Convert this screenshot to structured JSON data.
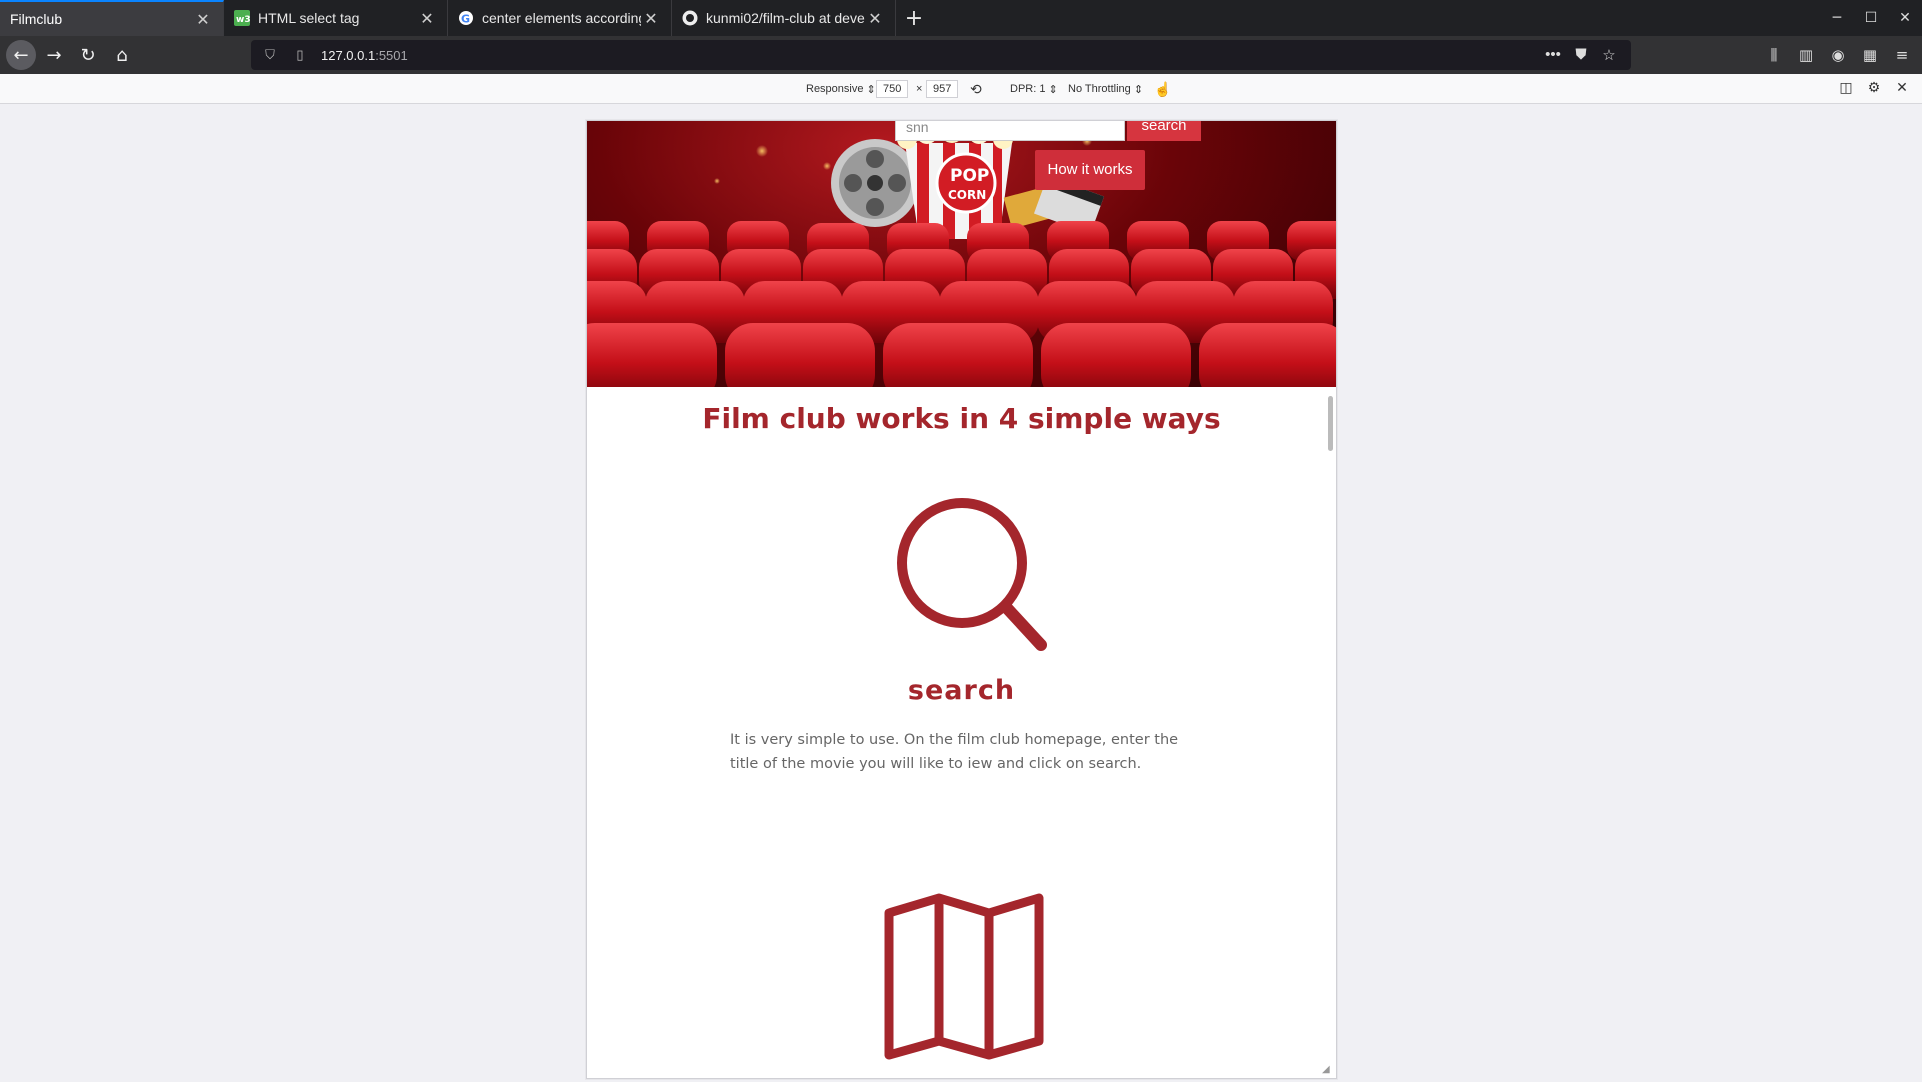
{
  "browser": {
    "tabs": [
      {
        "title": "Filmclub",
        "favicon": "blank",
        "active": true
      },
      {
        "title": "HTML select tag",
        "favicon": "w3schools-icon"
      },
      {
        "title": "center elements according to s",
        "favicon": "google-icon"
      },
      {
        "title": "kunmi02/film-club at developm",
        "favicon": "github-icon"
      }
    ],
    "url_host": "127.0.0.1",
    "url_port": ":5501"
  },
  "devtools": {
    "device": "Responsive",
    "width": "750",
    "separator": "×",
    "height": "957",
    "dpr": "DPR: 1",
    "throttling": "No Throttling"
  },
  "page": {
    "search_placeholder": "snn",
    "search_button": "search",
    "how_button": "How it works",
    "heading": "Film club works in 4 simple ways",
    "steps": [
      {
        "icon": "magnifier-icon",
        "title": "search",
        "text": "It is very simple to use. On the film club homepage, enter the title of the movie you will like to iew and click on search."
      },
      {
        "icon": "map-icon"
      }
    ]
  },
  "colors": {
    "accent": "#a4262c",
    "button": "#cf2e3a"
  }
}
